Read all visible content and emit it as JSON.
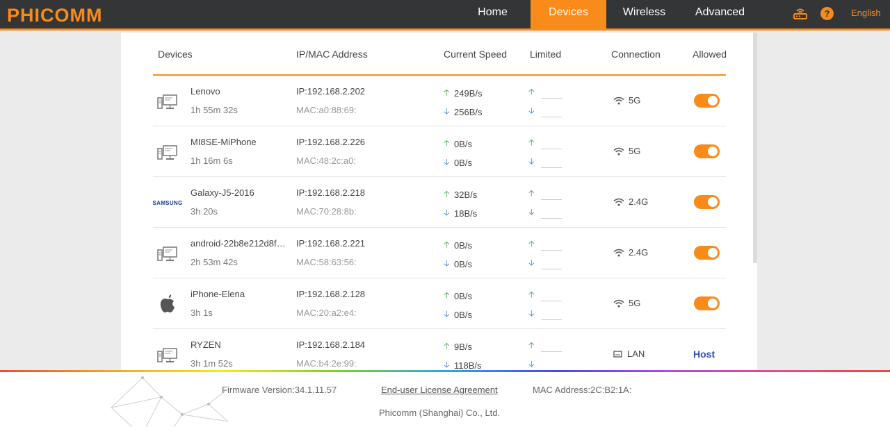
{
  "header": {
    "logo": "PHICOMM",
    "nav": [
      {
        "label": "Home",
        "active": false
      },
      {
        "label": "Devices",
        "active": true
      },
      {
        "label": "Wireless",
        "active": false
      },
      {
        "label": "Advanced",
        "active": false
      }
    ],
    "help": "?",
    "language": "English",
    "accent": "#f98b1a"
  },
  "table": {
    "headers": {
      "devices": "Devices",
      "ipmac": "IP/MAC Address",
      "speed": "Current Speed",
      "limited": "Limited",
      "connection": "Connection",
      "allowed": "Allowed"
    },
    "rows": [
      {
        "icon": "computer-icon",
        "name": "Lenovo",
        "time": "1h 55m 32s",
        "ip": "IP:192.168.2.202",
        "mac": "MAC:a0:88:69:",
        "up": "249B/s",
        "down": "256B/s",
        "conn_type": "wifi",
        "conn": "5G",
        "allowed": "toggle-on"
      },
      {
        "icon": "computer-icon",
        "name": "MI8SE-MiPhone",
        "time": "1h 16m 6s",
        "ip": "IP:192.168.2.226",
        "mac": "MAC:48:2c:a0:",
        "up": "0B/s",
        "down": "0B/s",
        "conn_type": "wifi",
        "conn": "5G",
        "allowed": "toggle-on"
      },
      {
        "icon": "samsung-logo",
        "brand": "SAMSUNG",
        "name": "Galaxy-J5-2016",
        "time": "3h 20s",
        "ip": "IP:192.168.2.218",
        "mac": "MAC:70:28:8b:",
        "up": "32B/s",
        "down": "18B/s",
        "conn_type": "wifi",
        "conn": "2.4G",
        "allowed": "toggle-on"
      },
      {
        "icon": "computer-icon",
        "name": "android-22b8e212d8f…",
        "time": "2h 53m 42s",
        "ip": "IP:192.168.2.221",
        "mac": "MAC:58:63:56:",
        "up": "0B/s",
        "down": "0B/s",
        "conn_type": "wifi",
        "conn": "2.4G",
        "allowed": "toggle-on"
      },
      {
        "icon": "apple-icon",
        "name": "iPhone-Elena",
        "time": "3h 1s",
        "ip": "IP:192.168.2.128",
        "mac": "MAC:20:a2:e4:",
        "up": "0B/s",
        "down": "0B/s",
        "conn_type": "wifi",
        "conn": "5G",
        "allowed": "toggle-on"
      },
      {
        "icon": "computer-icon",
        "name": "RYZEN",
        "time": "3h 1m 52s",
        "ip": "IP:192.168.2.184",
        "mac": "MAC:b4:2e:99:",
        "up": "9B/s",
        "down": "118B/s",
        "conn_type": "lan",
        "conn": "LAN",
        "allowed": "Host"
      }
    ]
  },
  "footer": {
    "firmware": "Firmware Version:34.1.11.57",
    "eula": "End-user License Agreement",
    "mac": "MAC Address:2C:B2:1A:",
    "company": "Phicomm (Shanghai) Co., Ltd."
  }
}
